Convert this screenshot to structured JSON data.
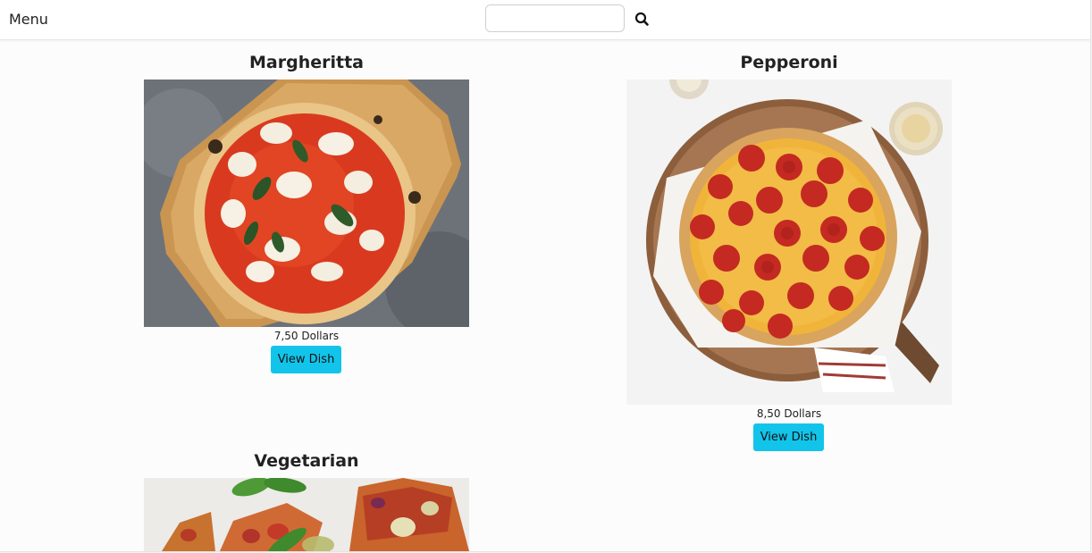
{
  "navbar": {
    "brand": "Menu",
    "search": {
      "value": "",
      "placeholder": ""
    },
    "search_icon": "magnifier-icon"
  },
  "dishes": [
    {
      "name": "Margheritta",
      "price": "7,50 Dollars",
      "button": "View Dish"
    },
    {
      "name": "Pepperoni",
      "price": "8,50 Dollars",
      "button": "View Dish"
    },
    {
      "name": "Vegetarian"
    }
  ],
  "colors": {
    "button": "#13c4ea",
    "background": "#fcfcfc"
  }
}
